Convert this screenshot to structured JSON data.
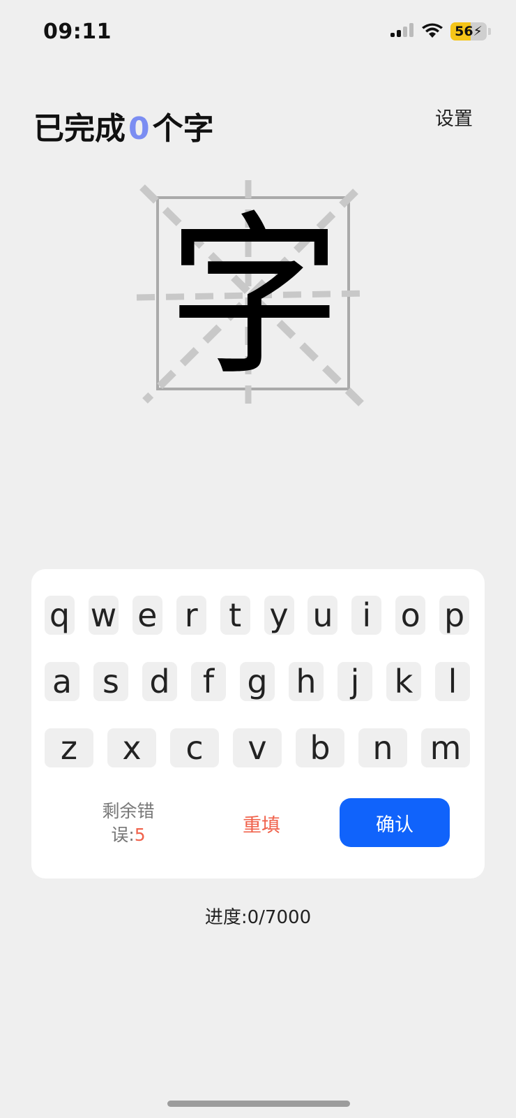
{
  "status_bar": {
    "time": "09:11",
    "battery_level": "56",
    "battery_fraction": 0.56,
    "battery_color": "#f5c518",
    "icons": [
      "cellular-signal-icon",
      "wifi-icon",
      "battery-charging-icon"
    ]
  },
  "header": {
    "prefix": "已完成",
    "count": "0",
    "suffix": "个字",
    "count_color": "#7b8df2",
    "settings_label": "设置"
  },
  "character": {
    "glyph": "字"
  },
  "keyboard": {
    "row1": [
      "q",
      "w",
      "e",
      "r",
      "t",
      "y",
      "u",
      "i",
      "o",
      "p"
    ],
    "row2": [
      "a",
      "s",
      "d",
      "f",
      "g",
      "h",
      "j",
      "k",
      "l"
    ],
    "row3": [
      "z",
      "x",
      "c",
      "v",
      "b",
      "n",
      "m"
    ],
    "remaining_errors_label": "剩余错误:",
    "remaining_errors_count": "5",
    "refill_label": "重填",
    "confirm_label": "确认",
    "accent_color": "#1063fb",
    "warning_color": "#f0624b"
  },
  "progress": {
    "text": "进度:0/7000"
  }
}
